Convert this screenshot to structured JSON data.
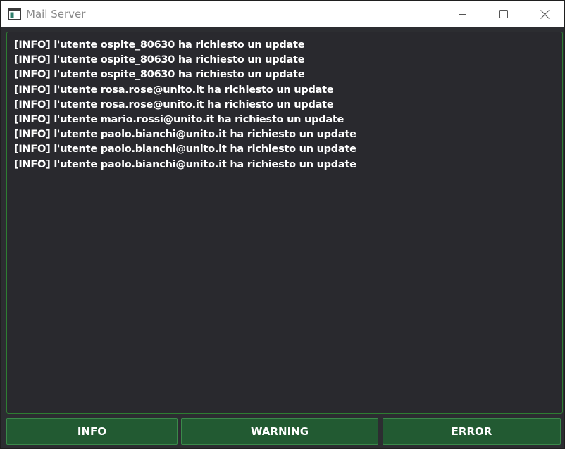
{
  "window": {
    "title": "Mail Server"
  },
  "log": {
    "lines": [
      "[INFO] l'utente ospite_80630 ha richiesto un update",
      "[INFO] l'utente ospite_80630 ha richiesto un update",
      "[INFO] l'utente ospite_80630 ha richiesto un update",
      "[INFO] l'utente rosa.rose@unito.it ha richiesto un update",
      "[INFO] l'utente rosa.rose@unito.it ha richiesto un update",
      "[INFO] l'utente mario.rossi@unito.it ha richiesto un update",
      "[INFO] l'utente paolo.bianchi@unito.it ha richiesto un update",
      "[INFO] l'utente paolo.bianchi@unito.it ha richiesto un update",
      "[INFO] l'utente paolo.bianchi@unito.it ha richiesto un update"
    ]
  },
  "buttons": {
    "info_label": "INFO",
    "warning_label": "WARNING",
    "error_label": "ERROR"
  },
  "icons": {
    "app": "app-window-icon",
    "minimize": "minimize-icon",
    "maximize": "maximize-icon",
    "close": "close-icon"
  },
  "colors": {
    "background": "#29292e",
    "accent_border": "#2e7d32",
    "button_fill": "#225a32",
    "text": "#ffffff"
  }
}
